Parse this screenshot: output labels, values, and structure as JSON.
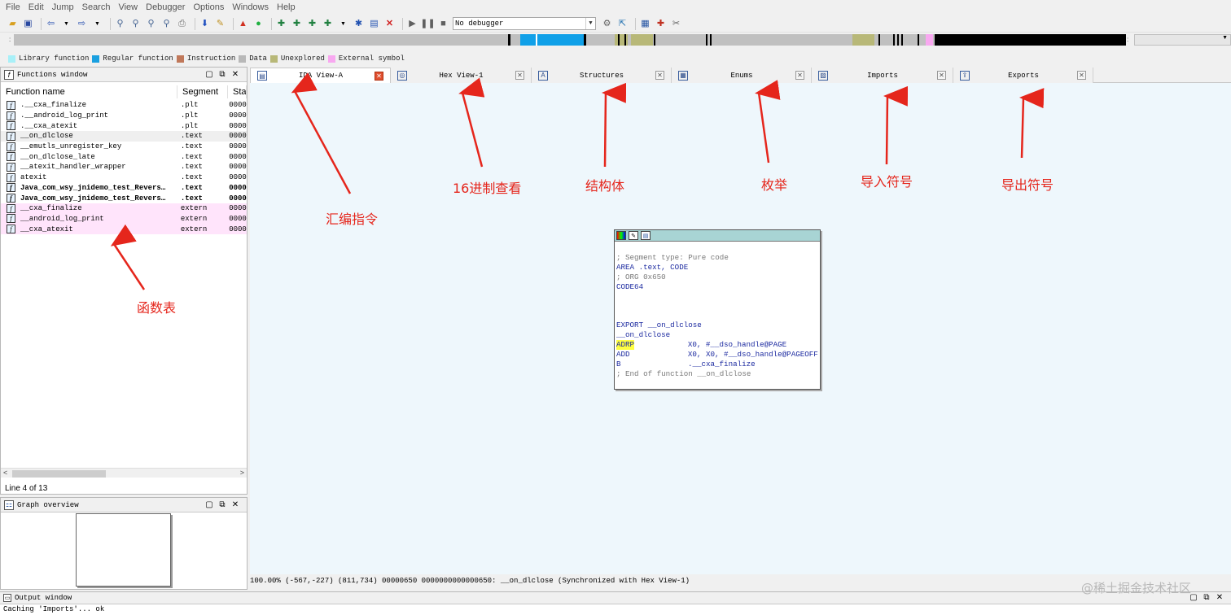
{
  "menu": [
    "File",
    "Edit",
    "Jump",
    "Search",
    "View",
    "Debugger",
    "Options",
    "Windows",
    "Help"
  ],
  "toolbar": {
    "debugger_select": "No debugger"
  },
  "navband": {
    "left_marker": ":",
    "right_marker": ":"
  },
  "legend": [
    {
      "label": "Library function",
      "color": "#a8f0f8"
    },
    {
      "label": "Regular function",
      "color": "#1aa0e0"
    },
    {
      "label": "Instruction",
      "color": "#c0785a"
    },
    {
      "label": "Data",
      "color": "#b8b8b8"
    },
    {
      "label": "Unexplored",
      "color": "#b8b878"
    },
    {
      "label": "External symbol",
      "color": "#f8a8f0"
    }
  ],
  "functions_window": {
    "title": "Functions window",
    "columns": {
      "name": "Function name",
      "segment": "Segment",
      "start": "Star"
    },
    "rows": [
      {
        "name": ".__cxa_finalize",
        "segment": ".plt",
        "start": "0000",
        "style": ""
      },
      {
        "name": ".__android_log_print",
        "segment": ".plt",
        "start": "0000",
        "style": ""
      },
      {
        "name": ".__cxa_atexit",
        "segment": ".plt",
        "start": "0000",
        "style": ""
      },
      {
        "name": "__on_dlclose",
        "segment": ".text",
        "start": "0000",
        "style": "sel"
      },
      {
        "name": "__emutls_unregister_key",
        "segment": ".text",
        "start": "0000",
        "style": ""
      },
      {
        "name": "__on_dlclose_late",
        "segment": ".text",
        "start": "0000",
        "style": ""
      },
      {
        "name": "__atexit_handler_wrapper",
        "segment": ".text",
        "start": "0000",
        "style": ""
      },
      {
        "name": "atexit",
        "segment": ".text",
        "start": "0000",
        "style": ""
      },
      {
        "name": "Java_com_wsy_jnidemo_test_Revers…",
        "segment": ".text",
        "start": "0000",
        "style": "bold"
      },
      {
        "name": "Java_com_wsy_jnidemo_test_Revers…",
        "segment": ".text",
        "start": "0000",
        "style": "bold"
      },
      {
        "name": "__cxa_finalize",
        "segment": "extern",
        "start": "0000",
        "style": "pink"
      },
      {
        "name": "__android_log_print",
        "segment": "extern",
        "start": "0000",
        "style": "pink"
      },
      {
        "name": "__cxa_atexit",
        "segment": "extern",
        "start": "0000",
        "style": "pink"
      }
    ],
    "status": "Line 4 of 13"
  },
  "graph_overview": {
    "title": "Graph overview"
  },
  "tabs": [
    {
      "label": "IDA View-A",
      "icon": "ida-view-icon",
      "active": true
    },
    {
      "label": "Hex View-1",
      "icon": "hex-view-icon",
      "active": false
    },
    {
      "label": "Structures",
      "icon": "structures-icon",
      "active": false
    },
    {
      "label": "Enums",
      "icon": "enums-icon",
      "active": false
    },
    {
      "label": "Imports",
      "icon": "imports-icon",
      "active": false
    },
    {
      "label": "Exports",
      "icon": "exports-icon",
      "active": false
    }
  ],
  "graph_node": {
    "lines": [
      {
        "text": "; Segment type: Pure code",
        "cls": "c-comment"
      },
      {
        "text": "AREA .text, CODE",
        "cls": "c-blue"
      },
      {
        "text": "; ORG 0x650",
        "cls": "c-comment"
      },
      {
        "text": "CODE64",
        "cls": "c-blue"
      },
      {
        "text": "",
        "cls": ""
      },
      {
        "text": "",
        "cls": ""
      },
      {
        "text": "",
        "cls": ""
      },
      {
        "text": "EXPORT __on_dlclose",
        "cls": "c-blue"
      },
      {
        "text": "__on_dlclose",
        "cls": "c-blue"
      },
      {
        "mnem": "ADRP",
        "ops": "X0, #__dso_handle@PAGE",
        "hl": true
      },
      {
        "mnem": "ADD",
        "ops": "X0, X0, #__dso_handle@PAGEOFF",
        "hl": false
      },
      {
        "mnem": "B",
        "ops": ".__cxa_finalize",
        "hl": false
      },
      {
        "text": "; End of function __on_dlclose",
        "cls": "c-comment"
      }
    ]
  },
  "view_status": "100.00% (-567,-227) (811,734) 00000650 0000000000000650: __on_dlclose (Synchronized with Hex View-1)",
  "output_window": {
    "title": "Output window",
    "text": "Caching 'Imports'... ok"
  },
  "annotations": {
    "disasm": "汇编指令",
    "hex": "16进制查看",
    "struct": "结构体",
    "enum": "枚举",
    "imports": "导入符号",
    "exports": "导出符号",
    "functions": "函数表",
    "color": "#e5261c"
  },
  "watermark": "@稀土掘金技术社区"
}
